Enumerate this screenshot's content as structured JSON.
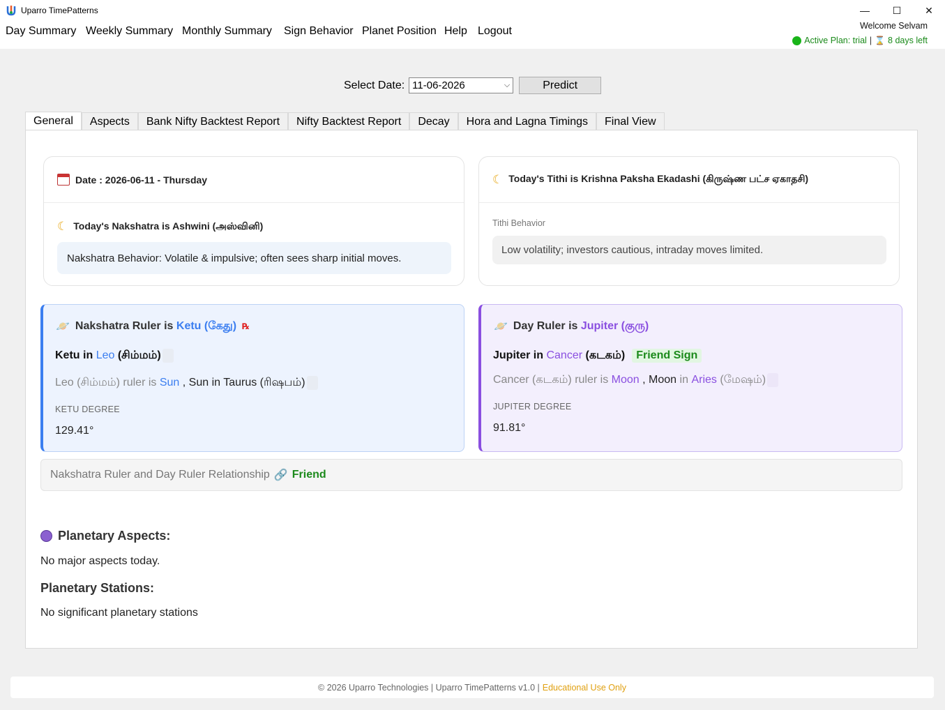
{
  "window": {
    "title": "Uparro TimePatterns",
    "minimize": "—",
    "maximize": "☐",
    "close": "✕"
  },
  "menu": {
    "items": [
      "Day Summary",
      "Weekly Summary",
      "Monthly Summary",
      "Sign Behavior",
      "Planet Position",
      "Help",
      "Logout"
    ]
  },
  "user": {
    "welcome": "Welcome Selvam",
    "plan": "Active Plan: trial",
    "separator": "|",
    "days_left": "8 days left"
  },
  "date_picker": {
    "label": "Select Date:",
    "value": "11-06-2026",
    "predict_label": "Predict"
  },
  "tabs": [
    "General",
    "Aspects",
    "Bank Nifty Backtest Report",
    "Nifty Backtest Report",
    "Decay",
    "Hora and Lagna Timings",
    "Final View"
  ],
  "date_card": {
    "title": "Date : 2026-06-11 - Thursday",
    "nakshatra_title": "Today's Nakshatra is Ashwini (அஸ்வினி)",
    "nakshatra_behavior": "Nakshatra Behavior: Volatile & impulsive; often sees sharp initial moves."
  },
  "tithi_card": {
    "title": "Today's Tithi is Krishna Paksha Ekadashi (கிருஷ்ண பட்ச ஏகாதசி)",
    "label": "Tithi Behavior",
    "behavior": "Low volatility; investors cautious, intraday moves limited."
  },
  "nakshatra_ruler": {
    "prefix": "Nakshatra Ruler is",
    "planet": "Ketu (கேது)",
    "retro_symbol": "℞",
    "planet_short": "Ketu",
    "in": "in",
    "sign": "Leo",
    "sign_tamil": "(சிம்மம்)",
    "line2_sign": "Leo (சிம்மம்) ruler is",
    "line2_ruler": "Sun",
    "line2_rest": ", Sun in Taurus (ரிஷபம்)",
    "degree_label": "KETU DEGREE",
    "degree": "129.41°",
    "accent": "#3b7ef0"
  },
  "day_ruler": {
    "prefix": "Day Ruler is",
    "planet": "Jupiter (குரு)",
    "planet_short": "Jupiter",
    "in": "in",
    "sign": "Cancer",
    "sign_tamil": "(கடகம்)",
    "badge": "Friend Sign",
    "line2_sign": "Cancer (கடகம்) ruler is",
    "line2_ruler": "Moon",
    "line2_mid": ", Moon",
    "line2_in": "in",
    "line2_target": "Aries",
    "line2_tamil": "(மேஷம்)",
    "degree_label": "JUPITER DEGREE",
    "degree": "91.81°",
    "accent": "#8a4fe0"
  },
  "relationship": {
    "label": "Nakshatra Ruler and Day Ruler Relationship",
    "value": "Friend"
  },
  "aspects": {
    "title": "Planetary Aspects:",
    "text": "No major aspects today."
  },
  "stations": {
    "title": "Planetary Stations:",
    "text": "No significant planetary stations"
  },
  "footer": {
    "text": "© 2026 Uparro Technologies | Uparro TimePatterns v1.0 |",
    "edu": "Educational Use Only"
  },
  "icons": {
    "app": "uparro-logo-icon",
    "calendar": "calendar-icon",
    "moon": "crescent-moon-icon",
    "planet": "ringed-planet-icon",
    "link": "link-icon",
    "crystal": "crystal-ball-icon",
    "status": "green-dot-icon",
    "hourglass": "hourglass-icon"
  }
}
